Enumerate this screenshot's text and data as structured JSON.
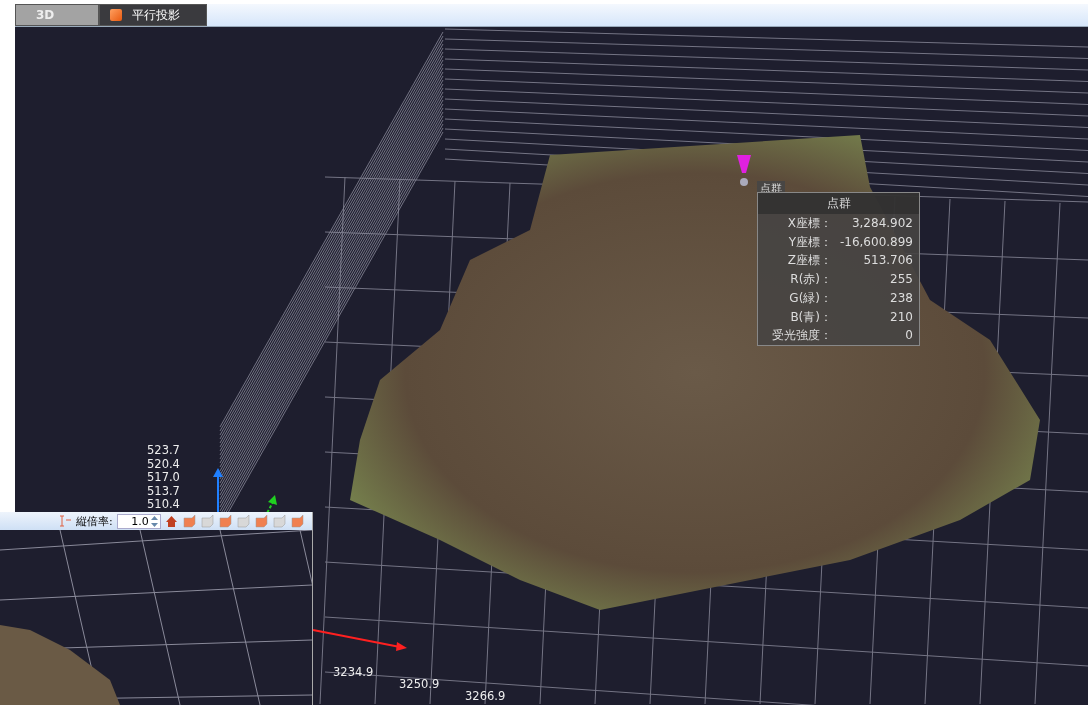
{
  "tabs": [
    {
      "label": "3D",
      "selected": false
    },
    {
      "label": "平行投影",
      "selected": true
    }
  ],
  "point_info": {
    "tag": "点群",
    "title": "点群",
    "rows": [
      {
        "label": "X座標：",
        "value": "3,284.902"
      },
      {
        "label": "Y座標：",
        "value": "-16,600.899"
      },
      {
        "label": "Z座標：",
        "value": "513.706"
      },
      {
        "label": "R(赤)：",
        "value": "255"
      },
      {
        "label": "G(緑)：",
        "value": "238"
      },
      {
        "label": "B(青)：",
        "value": "210"
      },
      {
        "label": "受光強度：",
        "value": "0"
      }
    ]
  },
  "z_axis_labels": [
    "523.7",
    "520.4",
    "517.0",
    "513.7",
    "510.4"
  ],
  "x_axis_labels": [
    "3234.9",
    "3250.9",
    "3266.9"
  ],
  "inset": {
    "scale_label": "縦倍率:",
    "scale_value": "1.0"
  }
}
